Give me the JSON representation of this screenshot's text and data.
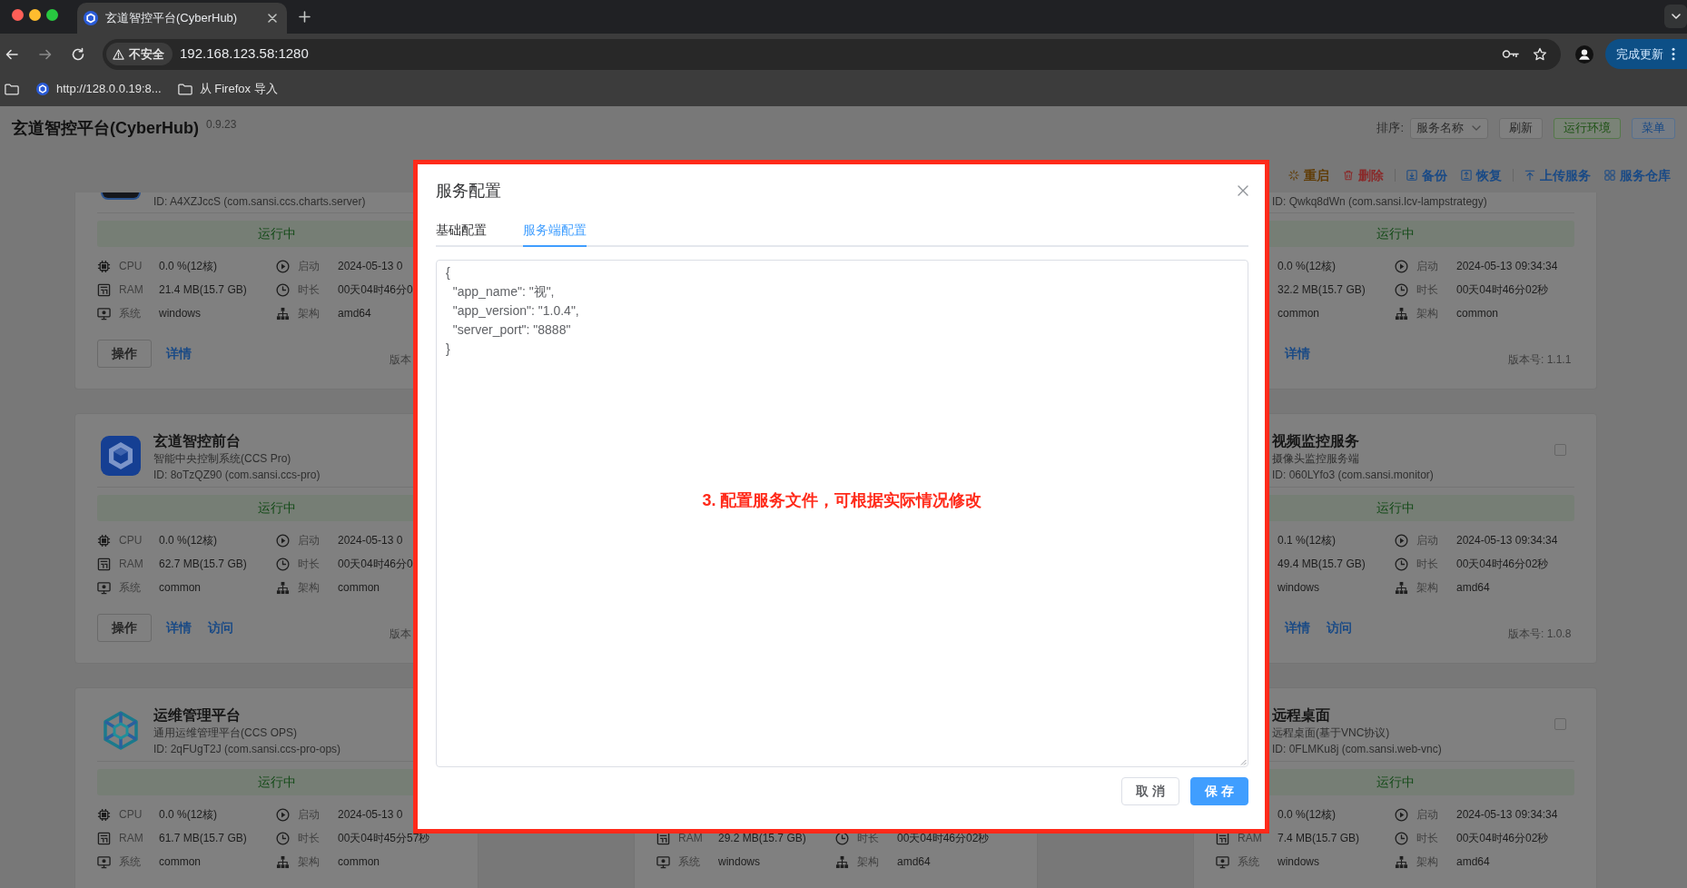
{
  "browser": {
    "tab_title": "玄道智控平台(CyberHub)",
    "security_label": "不安全",
    "url": "192.168.123.58:1280",
    "update_button": "完成更新",
    "bookmarks": [
      {
        "kind": "site",
        "label": "http://128.0.0.19:8..."
      },
      {
        "kind": "folder",
        "label": "从 Firefox 导入"
      }
    ]
  },
  "header": {
    "title": "玄道智控平台(CyberHub)",
    "version": "0.9.23",
    "sort_label": "排序:",
    "sort_value": "服务名称",
    "buttons": [
      {
        "kind": "default",
        "label": "刷新"
      },
      {
        "kind": "success",
        "label": "运行环境"
      },
      {
        "kind": "primary",
        "label": "菜单"
      }
    ]
  },
  "toolbar": {
    "groups": [
      {
        "items": [
          {
            "kind": "restart",
            "label": "重启"
          },
          {
            "kind": "delete",
            "label": "删除"
          }
        ]
      },
      {
        "items": [
          {
            "kind": "backup",
            "label": "备份"
          },
          {
            "kind": "restore",
            "label": "恢复"
          }
        ]
      },
      {
        "items": [
          {
            "kind": "upload",
            "label": "上传服务"
          },
          {
            "kind": "store",
            "label": "服务仓库"
          }
        ]
      }
    ]
  },
  "columns": [
    {
      "cards": [
        {
          "id": "ID: A4XZJccS (com.sansi.ccs.charts.server)",
          "status": "运行中",
          "metrics": [
            {
              "kind": "cpu",
              "label": "CPU",
              "value": "0.0 %(12核)",
              "label_2": "启动",
              "value_2": "2024-05-13 0"
            },
            {
              "kind": "ram",
              "label": "RAM",
              "value": "21.4 MB(15.7 GB)",
              "label_2": "时长",
              "value_2": "00天04时46分0"
            },
            {
              "kind": "system",
              "label": "系统",
              "value": "windows",
              "label_2": "架构",
              "value_2": "amd64"
            }
          ],
          "actions": [
            {
              "kind": "button",
              "label": "操作"
            },
            {
              "kind": "link",
              "label": "详情"
            }
          ],
          "version": "版本"
        },
        {
          "name": "玄道智控前台",
          "description": "智能中央控制系统(CCS Pro)",
          "id": "ID: 8oTzQZ90 (com.sansi.ccs-pro)",
          "status": "运行中",
          "metrics": [
            {
              "kind": "cpu",
              "label": "CPU",
              "value": "0.0 %(12核)",
              "label_2": "启动",
              "value_2": "2024-05-13 0"
            },
            {
              "kind": "ram",
              "label": "RAM",
              "value": "62.7 MB(15.7 GB)",
              "label_2": "时长",
              "value_2": "00天04时46分0"
            },
            {
              "kind": "system",
              "label": "系统",
              "value": "common",
              "label_2": "架构",
              "value_2": "common"
            }
          ],
          "actions": [
            {
              "kind": "button",
              "label": "操作"
            },
            {
              "kind": "link",
              "label": "详情"
            },
            {
              "kind": "link",
              "label": "访问"
            }
          ],
          "version": "版本"
        },
        {
          "name": "运维管理平台",
          "description": "通用运维管理平台(CCS OPS)",
          "id": "ID: 2qFUgT2J (com.sansi.ccs-pro-ops)",
          "status": "运行中",
          "metrics": [
            {
              "kind": "cpu",
              "label": "CPU",
              "value": "0.0 %(12核)",
              "label_2": "启动",
              "value_2": "2024-05-13 0"
            },
            {
              "kind": "ram",
              "label": "RAM",
              "value": "61.7 MB(15.7 GB)",
              "label_2": "时长",
              "value_2": "00天04时45分57秒"
            },
            {
              "kind": "system",
              "label": "系统",
              "value": "common",
              "label_2": "架构",
              "value_2": "common"
            }
          ]
        }
      ]
    },
    {
      "cards": [
        {
          "metrics": [
            {
              "kind": "ram",
              "label": "RAM",
              "value": "29.2 MB(15.7 GB)",
              "label_2": "时长",
              "value_2": "00天04时46分02秒"
            },
            {
              "kind": "system",
              "label": "系统",
              "value": "windows",
              "label_2": "架构",
              "value_2": "amd64"
            }
          ]
        }
      ]
    },
    {
      "cards": [
        {
          "id": "ID: Qwkq8dWn (com.sansi.lcv-lampstrategy)",
          "status": "运行中",
          "metrics": [
            {
              "kind": "cpu",
              "value": "0.0 %(12核)",
              "label_2": "启动",
              "value_2": "2024-05-13 09:34:34"
            },
            {
              "kind": "ram",
              "value": "32.2 MB(15.7 GB)",
              "label_2": "时长",
              "value_2": "00天04时46分02秒"
            },
            {
              "kind": "system",
              "value": "common",
              "label_2": "架构",
              "value_2": "common"
            }
          ],
          "actions": [
            {
              "kind": "link",
              "label": "详情"
            }
          ],
          "version": "版本号: 1.1.1"
        },
        {
          "name": "视频监控服务",
          "description": "摄像头监控服务端",
          "id": "ID: 060LYfo3 (com.sansi.monitor)",
          "checked": false,
          "status": "运行中",
          "metrics": [
            {
              "kind": "cpu",
              "value": "0.1 %(12核)",
              "label_2": "启动",
              "value_2": "2024-05-13 09:34:34"
            },
            {
              "kind": "ram",
              "value": "49.4 MB(15.7 GB)",
              "label_2": "时长",
              "value_2": "00天04时46分02秒"
            },
            {
              "kind": "system",
              "value": "windows",
              "label_2": "架构",
              "value_2": "amd64"
            }
          ],
          "actions": [
            {
              "kind": "link",
              "label": "详情"
            },
            {
              "kind": "link",
              "label": "访问"
            }
          ],
          "version": "版本号: 1.0.8"
        },
        {
          "name": "远程桌面",
          "description": "远程桌面(基于VNC协议)",
          "id": "ID: 0FLMKu8j (com.sansi.web-vnc)",
          "checked": false,
          "status": "运行中",
          "metrics": [
            {
              "kind": "cpu",
              "value": "0.0 %(12核)",
              "label_2": "启动",
              "value_2": "2024-05-13 09:34:34"
            },
            {
              "kind": "ram",
              "label": "RAM",
              "value": "7.4 MB(15.7 GB)",
              "label_2": "时长",
              "value_2": "00天04时46分02秒"
            },
            {
              "kind": "system",
              "label": "系统",
              "value": "windows",
              "label_2": "架构",
              "value_2": "amd64"
            }
          ]
        }
      ]
    }
  ],
  "dialog": {
    "title": "服务配置",
    "tabs": [
      {
        "label": "基础配置",
        "selected": false
      },
      {
        "label": "服务端配置",
        "selected": true
      }
    ],
    "editor": {
      "value": "{\n  \"app_name\": \"视\",\n  \"app_version\": \"1.0.4\",\n  \"server_port\": \"8888\"\n}"
    },
    "buttons": [
      {
        "kind": "default",
        "label": "取 消"
      },
      {
        "kind": "primary",
        "label": "保 存"
      }
    ]
  },
  "annotation": {
    "frame": true,
    "text": "3. 配置服务文件，可根据实际情况修改"
  }
}
